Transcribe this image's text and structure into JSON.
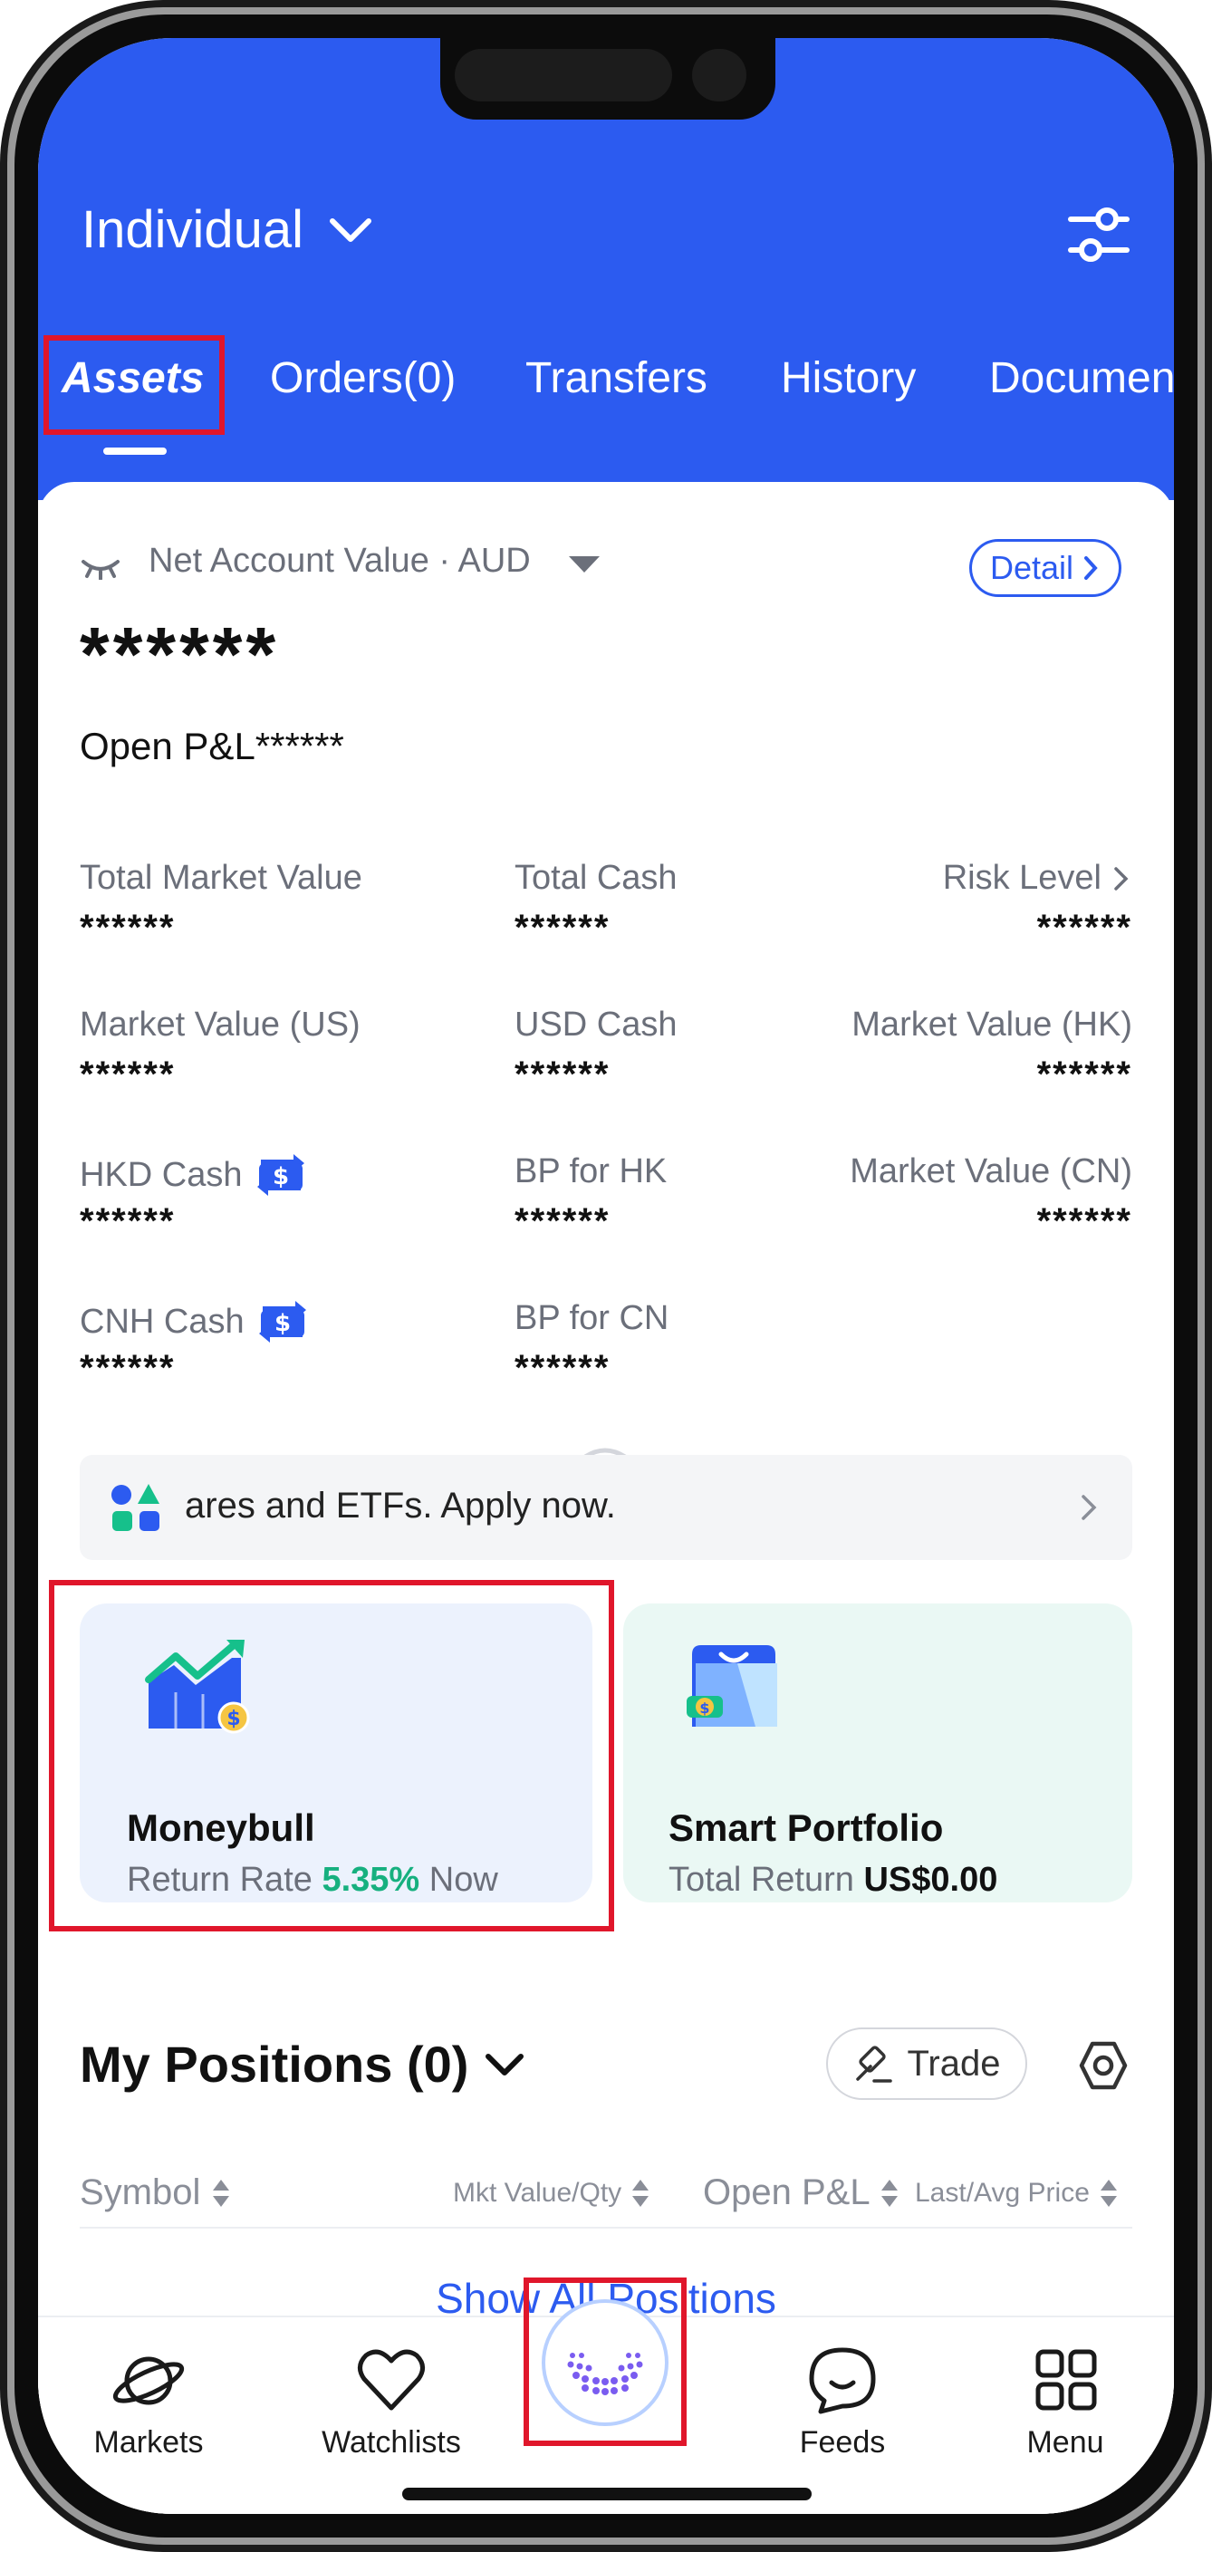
{
  "header": {
    "account_title": "Individual",
    "tabs": [
      {
        "label": "Assets",
        "active": true
      },
      {
        "label": "Orders(0)"
      },
      {
        "label": "Transfers"
      },
      {
        "label": "History"
      },
      {
        "label": "Documen"
      }
    ],
    "colors": {
      "brand": "#2c5bf0"
    }
  },
  "summary": {
    "net_label": "Net Account Value · AUD",
    "detail_label": "Detail",
    "net_value": "******",
    "open_pl": "Open P&L******"
  },
  "metrics": [
    {
      "label": "Total Market Value",
      "value": "******"
    },
    {
      "label": "Total Cash",
      "value": "******"
    },
    {
      "label": "Risk Level",
      "value": "******"
    },
    {
      "label": "Market Value (US)",
      "value": "******"
    },
    {
      "label": "USD Cash",
      "value": "******"
    },
    {
      "label": "Market Value (HK)",
      "value": "******"
    },
    {
      "label": "HKD Cash",
      "value": "******"
    },
    {
      "label": "BP for HK",
      "value": "******"
    },
    {
      "label": "Market Value (CN)",
      "value": "******"
    },
    {
      "label": "CNH Cash",
      "value": "******"
    },
    {
      "label": "BP for CN",
      "value": "******"
    }
  ],
  "banner": {
    "text": "ares and ETFs. Apply now."
  },
  "promo": {
    "moneybull": {
      "title": "Moneybull",
      "rate_label": "Return Rate",
      "rate_value": "5.35%",
      "suffix": "Now"
    },
    "smart": {
      "title": "Smart Portfolio",
      "return_label": "Total Return",
      "return_value": "US$0.00"
    }
  },
  "positions": {
    "title": "My Positions (0)",
    "trade_label": "Trade",
    "columns": [
      "Symbol",
      "Mkt Value/Qty",
      "Open P&L",
      "Last/Avg Price"
    ],
    "show_all": "Show All Positions"
  },
  "bottom_nav": {
    "items": [
      {
        "label": "Markets",
        "icon": "planet-icon"
      },
      {
        "label": "Watchlists",
        "icon": "heart-icon"
      },
      {
        "label": "",
        "icon": "ai-assistant-icon"
      },
      {
        "label": "Feeds",
        "icon": "chat-bubble-icon"
      },
      {
        "label": "Menu",
        "icon": "grid-icon"
      }
    ]
  }
}
